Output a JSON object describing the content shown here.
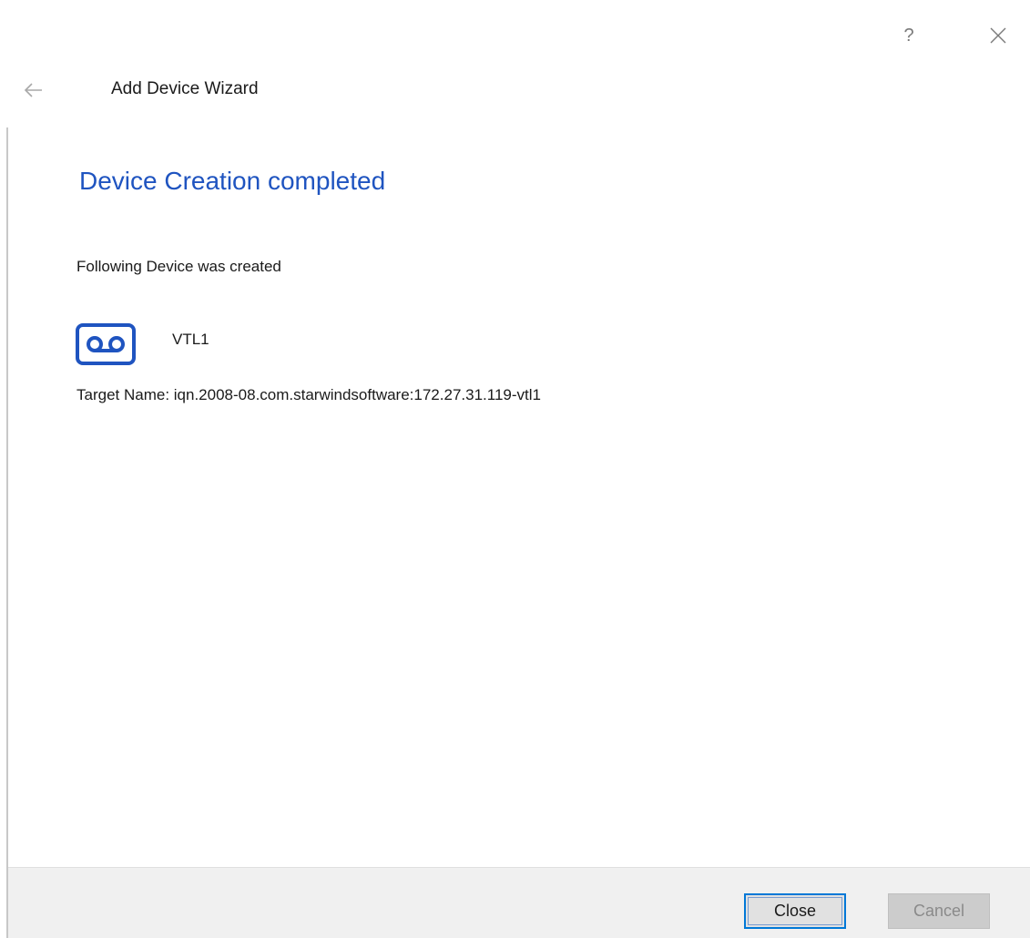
{
  "window": {
    "title": "Add Device Wizard",
    "help_glyph": "?",
    "close_glyph": "✕"
  },
  "page": {
    "heading": "Device Creation completed",
    "intro": "Following Device was created"
  },
  "device": {
    "icon": "tape-cassette-icon",
    "name": "VTL1",
    "target_line": "Target Name: iqn.2008-08.com.starwindsoftware:172.27.31.119-vtl1"
  },
  "footer": {
    "close_label": "Close",
    "cancel_label": "Cancel"
  },
  "colors": {
    "accent": "#1f54c0",
    "focus_border": "#0078d7",
    "footer_bg": "#f0f0f0"
  }
}
